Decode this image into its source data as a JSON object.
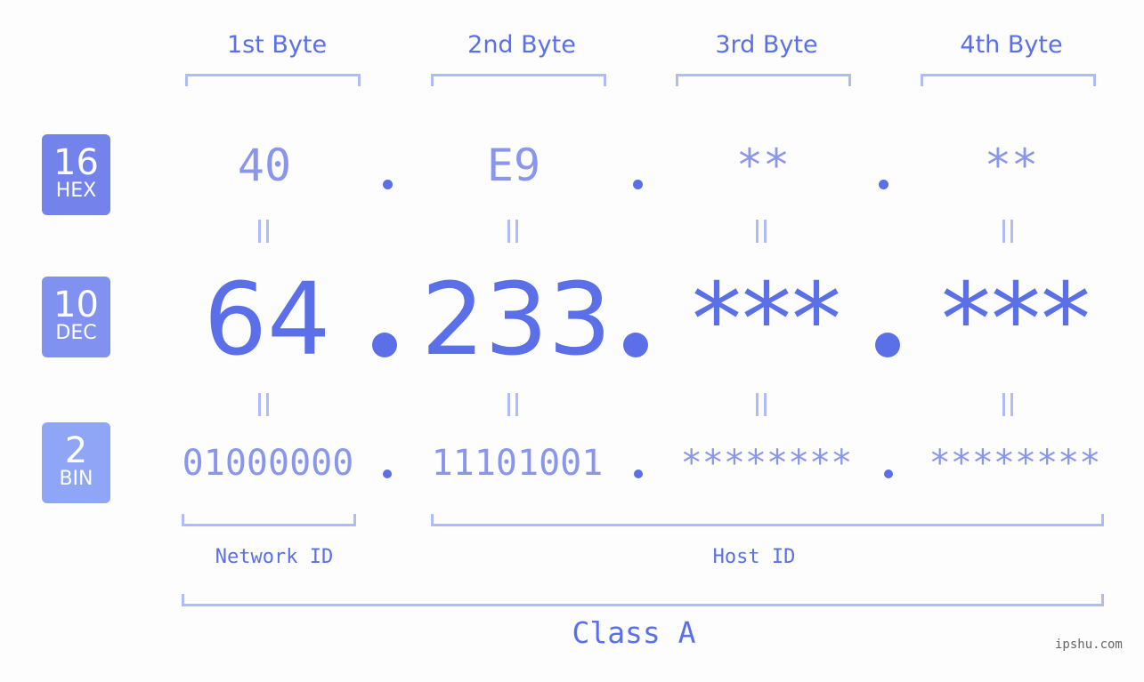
{
  "bytes": {
    "headers": [
      "1st Byte",
      "2nd Byte",
      "3rd Byte",
      "4th Byte"
    ]
  },
  "rows": {
    "hex": {
      "base": "16",
      "label": "HEX",
      "values": [
        "40",
        "E9",
        "**",
        "**"
      ]
    },
    "dec": {
      "base": "10",
      "label": "DEC",
      "values": [
        "64",
        "233",
        "***",
        "***"
      ]
    },
    "bin": {
      "base": "2",
      "label": "BIN",
      "values": [
        "01000000",
        "11101001",
        "********",
        "********"
      ]
    }
  },
  "groups": {
    "network_id": "Network ID",
    "host_id": "Host ID",
    "class_label": "Class A"
  },
  "colors": {
    "accent": "#5a6fe8",
    "light_accent": "#8a95ec",
    "bracket": "#b1bbf8",
    "hex_badge": "#7483ec",
    "dec_badge": "#8191f0",
    "bin_badge": "#8fa6f7"
  },
  "watermark": "ipshu.com"
}
